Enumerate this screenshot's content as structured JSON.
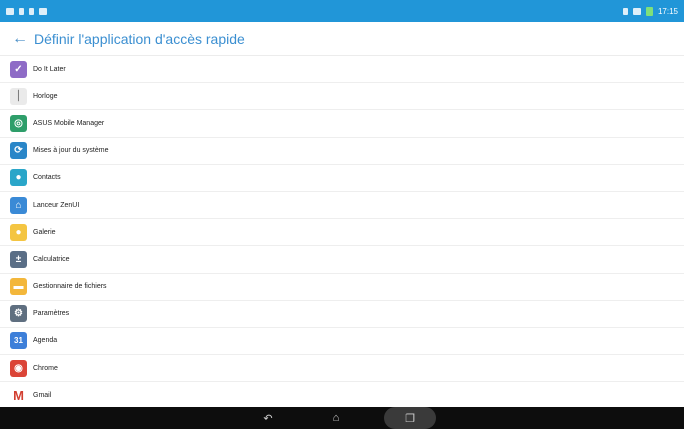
{
  "status_bar": {
    "time": "17:15"
  },
  "header": {
    "back_glyph": "←",
    "title": "Définir l'application d'accès rapide"
  },
  "apps": [
    {
      "label": "Do It Later",
      "icon": "do-it-later-icon",
      "glyph": "✓",
      "color": "#8e6bc6"
    },
    {
      "label": "Horloge",
      "icon": "clock-icon",
      "glyph": "⏐",
      "color": "#eaeaea"
    },
    {
      "label": "ASUS Mobile Manager",
      "icon": "mobile-manager-icon",
      "glyph": "◎",
      "color": "#2e9e6a"
    },
    {
      "label": "Mises à jour du système",
      "icon": "system-update-icon",
      "glyph": "⟳",
      "color": "#2a86c8"
    },
    {
      "label": "Contacts",
      "icon": "contacts-icon",
      "glyph": "●",
      "color": "#2aa6c9"
    },
    {
      "label": "Lanceur ZenUI",
      "icon": "zenui-launcher-icon",
      "glyph": "⌂",
      "color": "#3a8ad6"
    },
    {
      "label": "Galerie",
      "icon": "gallery-icon",
      "glyph": "●",
      "color": "#f4c542"
    },
    {
      "label": "Calculatrice",
      "icon": "calculator-icon",
      "glyph": "±",
      "color": "#5a6e86"
    },
    {
      "label": "Gestionnaire de fichiers",
      "icon": "file-manager-icon",
      "glyph": "▬",
      "color": "#f3b73b"
    },
    {
      "label": "Paramètres",
      "icon": "settings-icon",
      "glyph": "⚙",
      "color": "#5f6f80"
    },
    {
      "label": "Agenda",
      "icon": "calendar-icon",
      "glyph": "31",
      "color": "#3d7fd9"
    },
    {
      "label": "Chrome",
      "icon": "chrome-icon",
      "glyph": "◉",
      "color": "#db4437"
    },
    {
      "label": "Gmail",
      "icon": "gmail-icon",
      "glyph": "M",
      "color": "#ffffff"
    }
  ],
  "nav": {
    "back": "↶",
    "home": "⌂",
    "recent": "❐"
  }
}
